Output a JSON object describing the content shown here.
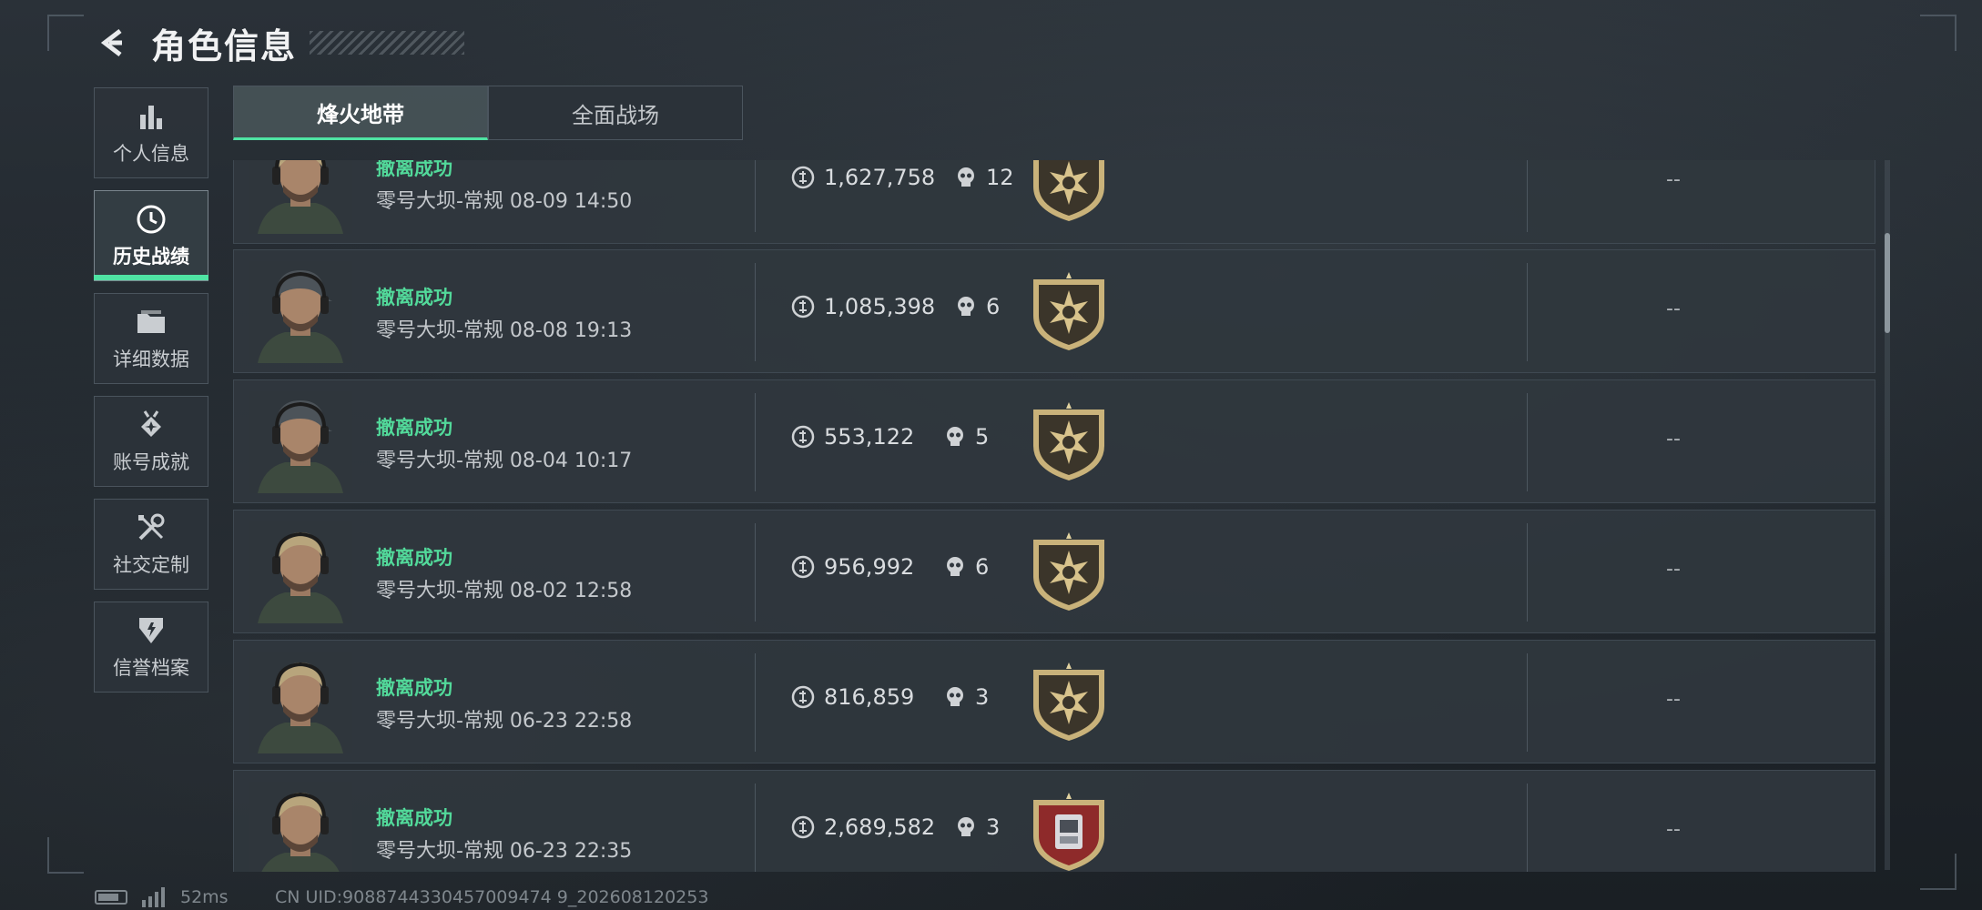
{
  "header": {
    "title": "角色信息"
  },
  "sidebar": {
    "items": [
      {
        "label": "个人信息",
        "icon": "bar-chart-icon"
      },
      {
        "label": "历史战绩",
        "icon": "clock-icon",
        "active": true
      },
      {
        "label": "详细数据",
        "icon": "folder-icon"
      },
      {
        "label": "账号成就",
        "icon": "medal-icon"
      },
      {
        "label": "社交定制",
        "icon": "tools-icon"
      },
      {
        "label": "信誉档案",
        "icon": "shield-icon"
      }
    ]
  },
  "tabs": [
    {
      "label": "烽火地带",
      "active": true
    },
    {
      "label": "全面战场",
      "active": false
    }
  ],
  "matches": [
    {
      "status": "撤离成功",
      "map": "零号大坝-常规 08-09 14:50",
      "value": "1,627,758",
      "kills": "12",
      "badge": "gold-emblem",
      "extra": "--"
    },
    {
      "status": "撤离成功",
      "map": "零号大坝-常规 08-08 19:13",
      "value": "1,085,398",
      "kills": "6",
      "badge": "gold-emblem",
      "extra": "--"
    },
    {
      "status": "撤离成功",
      "map": "零号大坝-常规 08-04 10:17",
      "value": "553,122",
      "kills": "5",
      "badge": "gold-emblem",
      "extra": "--"
    },
    {
      "status": "撤离成功",
      "map": "零号大坝-常规 08-02 12:58",
      "value": "956,992",
      "kills": "6",
      "badge": "gold-emblem",
      "extra": "--"
    },
    {
      "status": "撤离成功",
      "map": "零号大坝-常规 06-23 22:58",
      "value": "816,859",
      "kills": "3",
      "badge": "gold-emblem",
      "extra": "--"
    },
    {
      "status": "撤离成功",
      "map": "零号大坝-常规 06-23 22:35",
      "value": "2,689,582",
      "kills": "3",
      "badge": "red-emblem",
      "extra": "--"
    }
  ],
  "footer": {
    "ping": "52ms",
    "uid": "CN UID:9088744330457009474 9_202608120253"
  },
  "colors": {
    "accent": "#4fe3a3",
    "success": "#52d99a",
    "gold": "#c9b27a",
    "red_badge": "#8e2a2a"
  }
}
